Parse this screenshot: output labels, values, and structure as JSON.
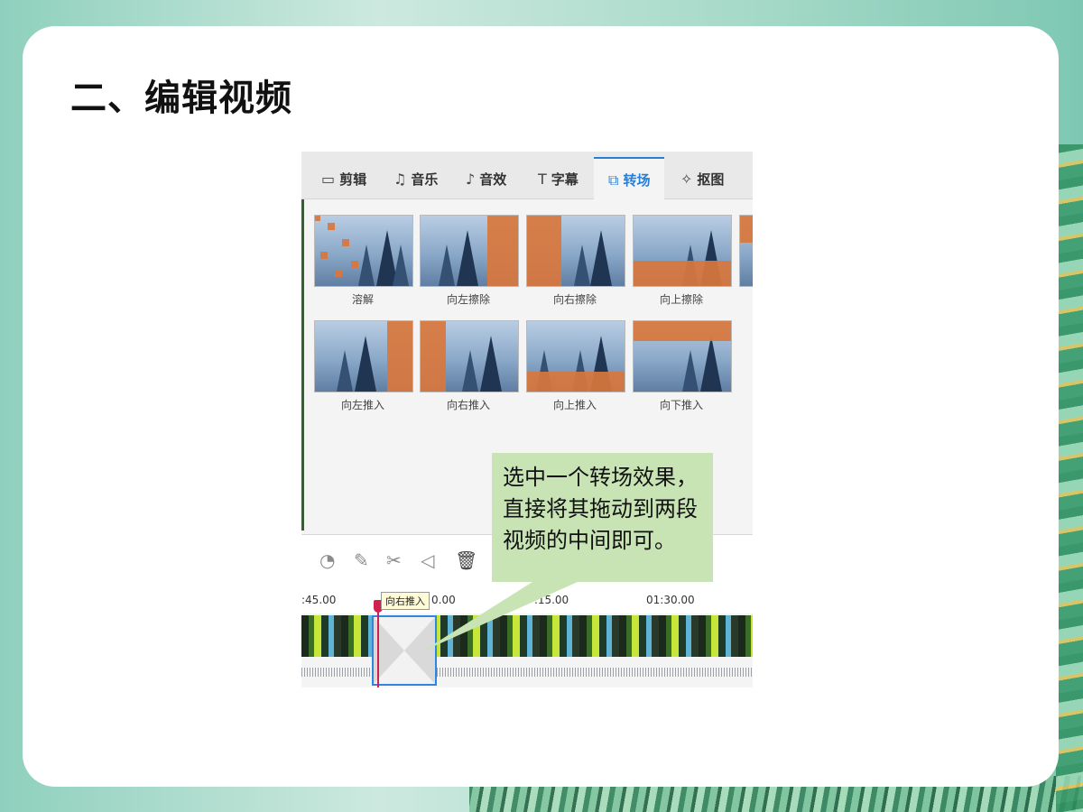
{
  "slide": {
    "title": "二、编辑视频"
  },
  "editor": {
    "tabs": [
      {
        "label": "剪辑",
        "icon": "video-clip-icon"
      },
      {
        "label": "音乐",
        "icon": "music-icon"
      },
      {
        "label": "音效",
        "icon": "sound-effect-icon"
      },
      {
        "label": "字幕",
        "icon": "text-icon"
      },
      {
        "label": "转场",
        "icon": "transition-icon",
        "active": true
      },
      {
        "label": "抠图",
        "icon": "cutout-icon"
      }
    ],
    "transitions": [
      {
        "label": "溶解"
      },
      {
        "label": "向左擦除"
      },
      {
        "label": "向右擦除"
      },
      {
        "label": "向上擦除"
      },
      {
        "label": "向左推入"
      },
      {
        "label": "向右推入"
      },
      {
        "label": "向上推入"
      },
      {
        "label": "向下推入"
      }
    ],
    "timeline": {
      "ticks": [
        ":45.00",
        "0.00",
        ".15.00",
        "01:30.00"
      ],
      "tooltip": "向右推入"
    }
  },
  "callout": {
    "lines": [
      "选中一个转场效果，",
      "直接将其拖动到两段",
      "视频的中间即可。"
    ]
  },
  "colors": {
    "accent": "#2a7fd4",
    "callout_bg": "#c8e3b4",
    "overlay": "#d9773d",
    "playhead": "#d0204d"
  }
}
